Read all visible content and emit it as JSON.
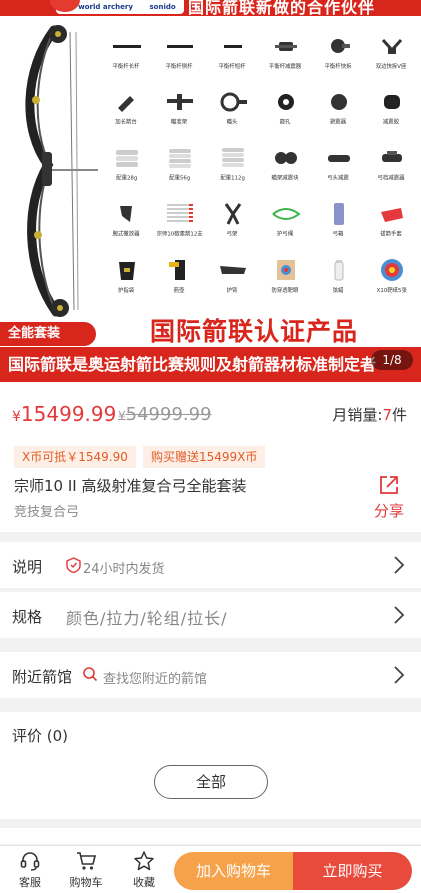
{
  "hero": {
    "logo_text_1": "world archery",
    "logo_text_2": "sonido",
    "top_text": "国际箭联新做的合作伙伴",
    "accessories": [
      [
        "平衡杆长杆",
        "平衡杆侧杆",
        "平衡杆短杆",
        "平衡杆减震器",
        "平衡杆快拆",
        "双边快拆V座"
      ],
      [
        "加长箭台",
        "瞄准架",
        "瞄头",
        "窥孔",
        "避震器",
        "减震胶"
      ],
      [
        "配重28g",
        "配重56g",
        "配重112g",
        "瞄架减震块",
        "弓头减震",
        "弓档减震器"
      ],
      [
        "腕式撒放器",
        "宗师10碳素箭12支",
        "弓架",
        "护弓绳",
        "弓箱",
        "拔箭手套"
      ],
      [
        "护指袋",
        "箭壶",
        "护臂",
        "防穿透靶眼",
        "弦蜡",
        "X10靶纸5张"
      ]
    ],
    "tag": "全能套装",
    "cert": "国际箭联认证产品",
    "bottom_text": "国际箭联是奥运射箭比赛规则及射箭器材标准制定者",
    "pager": "1/8"
  },
  "product": {
    "currency": "¥",
    "price": "15499.99",
    "original_price": "54999.99",
    "sales_label": "月销量:",
    "sales_count": "7",
    "sales_unit": "件",
    "coupon_1": "X币可抵￥1549.90",
    "coupon_2": "购买赠送15499X币",
    "title": "宗师10 II 高级射准复合弓全能套装",
    "subtitle": "竞技复合弓",
    "share_label": "分享"
  },
  "rows": {
    "desc_label": "说明",
    "desc_value": "24小时内发货",
    "spec_label": "规格",
    "spec_value": "颜色/拉力/轮组/拉长/",
    "nearby_label": "附近箭馆",
    "nearby_value": "查找您附近的箭馆"
  },
  "reviews": {
    "title": "评价 (0)",
    "all_button": "全部"
  },
  "bottom_bar": {
    "service_label": "客服",
    "cart_label": "购物车",
    "fav_label": "收藏",
    "add_cart_label": "加入购物车",
    "buy_now_label": "立即购买"
  },
  "colors": {
    "brand_red": "#d8261c",
    "price_red": "#e4393c",
    "add_cart_orange": "#f6a24a",
    "buy_red": "#e84a3c"
  }
}
